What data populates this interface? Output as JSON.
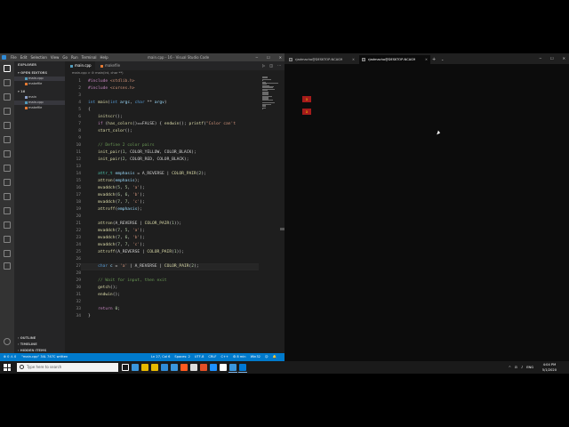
{
  "vscode": {
    "titlebar": {
      "menu": [
        "File",
        "Edit",
        "Selection",
        "View",
        "Go",
        "Run",
        "Terminal",
        "Help"
      ],
      "title": "main.cpp - 16 - Visual Studio Code",
      "min": "─",
      "max": "☐",
      "close": "✕"
    },
    "sidebar": {
      "explorer_title": "EXPLORER",
      "open_editors_label": "OPEN EDITORS",
      "open_editors": [
        {
          "name": "main.cpp",
          "type": "cpp"
        },
        {
          "name": "makefile",
          "type": "mk"
        }
      ],
      "folder_label": "16",
      "files": [
        {
          "name": "main",
          "type": "bin"
        },
        {
          "name": "main.cpp",
          "type": "cpp"
        },
        {
          "name": "makefile",
          "type": "mk"
        }
      ],
      "outline_label": "OUTLINE",
      "timeline_label": "TIMELINE",
      "hidden_items_label": "HIDDEN ITEMS"
    },
    "tabs": [
      {
        "label": "main.cpp",
        "type": "cpp",
        "active": true
      },
      {
        "label": "makefile",
        "type": "mk",
        "active": false
      }
    ],
    "breadcrumb": "main.cpp > ⊘ main(int, char **)",
    "editor": {
      "lines": [
        [
          [
            "c",
            "#include "
          ],
          [
            "s",
            "<stdlib.h>"
          ]
        ],
        [
          [
            "c",
            "#include "
          ],
          [
            "s",
            "<curses.h>"
          ]
        ],
        [],
        [
          [
            "k",
            "int "
          ],
          [
            "f",
            "main"
          ],
          [
            "",
            "("
          ],
          [
            "k",
            "int "
          ],
          [
            "v",
            "argc"
          ],
          [
            "",
            ", "
          ],
          [
            "k",
            "char "
          ],
          [
            "",
            "** "
          ],
          [
            "v",
            "argv"
          ],
          [
            "",
            ")"
          ]
        ],
        [
          [
            "",
            "{"
          ]
        ],
        [
          [
            "",
            "    "
          ],
          [
            "f",
            "initscr"
          ],
          [
            "",
            "();"
          ]
        ],
        [
          [
            "",
            "    "
          ],
          [
            "c",
            "if "
          ],
          [
            "",
            "("
          ],
          [
            "f",
            "has_colors"
          ],
          [
            "",
            "()==FALSE) { "
          ],
          [
            "f",
            "endwin"
          ],
          [
            "",
            "(); "
          ],
          [
            "f",
            "printf"
          ],
          [
            "",
            "("
          ],
          [
            "s",
            "\"Color can't"
          ]
        ],
        [
          [
            "",
            "    "
          ],
          [
            "f",
            "start_color"
          ],
          [
            "",
            "();"
          ]
        ],
        [],
        [
          [
            "",
            "    "
          ],
          [
            "cm",
            "// Define 2 color pairs"
          ]
        ],
        [
          [
            "",
            "    "
          ],
          [
            "f",
            "init_pair"
          ],
          [
            "",
            "("
          ],
          [
            "n",
            "1"
          ],
          [
            "",
            ", COLOR_YELLOW, COLOR_BLACK);"
          ]
        ],
        [
          [
            "",
            "    "
          ],
          [
            "f",
            "init_pair"
          ],
          [
            "",
            "("
          ],
          [
            "n",
            "2"
          ],
          [
            "",
            ", COLOR_RED, COLOR_BLACK);"
          ]
        ],
        [],
        [
          [
            "",
            "    "
          ],
          [
            "t",
            "attr_t "
          ],
          [
            "v",
            "emphasis"
          ],
          [
            "",
            " = A_REVERSE | "
          ],
          [
            "f",
            "COLOR_PAIR"
          ],
          [
            "",
            "("
          ],
          [
            "n",
            "2"
          ],
          [
            "",
            ");"
          ]
        ],
        [
          [
            "",
            "    "
          ],
          [
            "f",
            "attron"
          ],
          [
            "",
            "("
          ],
          [
            "v",
            "emphasis"
          ],
          [
            "",
            ");"
          ]
        ],
        [
          [
            "",
            "    "
          ],
          [
            "f",
            "mvaddch"
          ],
          [
            "",
            "("
          ],
          [
            "n",
            "5"
          ],
          [
            "",
            ", "
          ],
          [
            "n",
            "5"
          ],
          [
            "",
            ", "
          ],
          [
            "s",
            "'a'"
          ],
          [
            "",
            ");"
          ]
        ],
        [
          [
            "",
            "    "
          ],
          [
            "f",
            "mvaddch"
          ],
          [
            "",
            "("
          ],
          [
            "n",
            "6"
          ],
          [
            "",
            ", "
          ],
          [
            "n",
            "6"
          ],
          [
            "",
            ", "
          ],
          [
            "s",
            "'b'"
          ],
          [
            "",
            ");"
          ]
        ],
        [
          [
            "",
            "    "
          ],
          [
            "f",
            "mvaddch"
          ],
          [
            "",
            "("
          ],
          [
            "n",
            "7"
          ],
          [
            "",
            ", "
          ],
          [
            "n",
            "7"
          ],
          [
            "",
            ", "
          ],
          [
            "s",
            "'c'"
          ],
          [
            "",
            ");"
          ]
        ],
        [
          [
            "",
            "    "
          ],
          [
            "f",
            "attroff"
          ],
          [
            "",
            "("
          ],
          [
            "v",
            "emphasis"
          ],
          [
            "",
            ");"
          ]
        ],
        [],
        [
          [
            "",
            "    "
          ],
          [
            "f",
            "attron"
          ],
          [
            "",
            "(A_REVERSE | "
          ],
          [
            "f",
            "COLOR_PAIR"
          ],
          [
            "",
            "("
          ],
          [
            "n",
            "1"
          ],
          [
            "",
            "));"
          ]
        ],
        [
          [
            "",
            "    "
          ],
          [
            "f",
            "mvaddch"
          ],
          [
            "",
            "("
          ],
          [
            "n",
            "7"
          ],
          [
            "",
            ", "
          ],
          [
            "n",
            "5"
          ],
          [
            "",
            ", "
          ],
          [
            "s",
            "'a'"
          ],
          [
            "",
            ");"
          ]
        ],
        [
          [
            "",
            "    "
          ],
          [
            "f",
            "mvaddch"
          ],
          [
            "",
            "("
          ],
          [
            "n",
            "7"
          ],
          [
            "",
            ", "
          ],
          [
            "n",
            "6"
          ],
          [
            "",
            ", "
          ],
          [
            "s",
            "'b'"
          ],
          [
            "",
            ");"
          ]
        ],
        [
          [
            "",
            "    "
          ],
          [
            "f",
            "mvaddch"
          ],
          [
            "",
            "("
          ],
          [
            "n",
            "7"
          ],
          [
            "",
            ", "
          ],
          [
            "n",
            "7"
          ],
          [
            "",
            ", "
          ],
          [
            "s",
            "'c'"
          ],
          [
            "",
            ");"
          ]
        ],
        [
          [
            "",
            "    "
          ],
          [
            "f",
            "attroff"
          ],
          [
            "",
            "(A_REVERSE | "
          ],
          [
            "f",
            "COLOR_PAIR"
          ],
          [
            "",
            "("
          ],
          [
            "n",
            "1"
          ],
          [
            "",
            "));"
          ]
        ],
        [],
        [
          [
            "",
            "    "
          ],
          [
            "k",
            "char "
          ],
          [
            "v",
            "c"
          ],
          [
            "",
            " = "
          ],
          [
            "s",
            "'a'"
          ],
          [
            "",
            " | A_REVERSE | "
          ],
          [
            "f",
            "COLOR_PAIR"
          ],
          [
            "",
            "("
          ],
          [
            "n",
            "2"
          ],
          [
            "",
            ");"
          ]
        ],
        [],
        [
          [
            "",
            "    "
          ],
          [
            "cm",
            "// Wait for input, then exit"
          ]
        ],
        [
          [
            "",
            "    "
          ],
          [
            "f",
            "getch"
          ],
          [
            "",
            "();"
          ]
        ],
        [
          [
            "",
            "    "
          ],
          [
            "f",
            "endwin"
          ],
          [
            "",
            "();"
          ]
        ],
        [],
        [
          [
            "",
            "    "
          ],
          [
            "c",
            "return "
          ],
          [
            "n",
            "0"
          ],
          [
            "",
            ";"
          ]
        ],
        [
          [
            "",
            "}"
          ]
        ]
      ],
      "current_line": 27
    },
    "statusbar": {
      "left": [
        "⊗ 0 ⚠ 0",
        "\"main.cpp\" 34L 747C written"
      ],
      "right": [
        "Ln 27, Col 6",
        "Spaces: 2",
        "UTF-8",
        "CRLF",
        "C++",
        "⚙ 8 min",
        "Win32",
        "☺",
        "🔔"
      ]
    }
  },
  "terminal": {
    "tabs": [
      {
        "label": "rjadmacho@DESKTOP-NCAG9",
        "active": false
      },
      {
        "label": "rjadmacho@DESKTOP-NCAG9",
        "active": true
      }
    ],
    "new_tab": "+",
    "dropdown": "⌄",
    "min": "─",
    "max": "☐",
    "close": "✕",
    "cells": [
      "a",
      "a"
    ]
  },
  "taskbar": {
    "search_placeholder": "Type here to search",
    "time": "4:04 PM",
    "date": "5/1/2020",
    "tray": [
      "^",
      "⊡",
      "♪",
      "ENG"
    ],
    "app_colors": [
      "#ffffff",
      "#3a96dd",
      "#e6b800",
      "#e6b800",
      "#2f8bd8",
      "#3a96dd",
      "#ff5a1f",
      "#dddddd",
      "#e34f26",
      "#1e90ff",
      "#ffffff",
      "#3a96dd",
      "#0078d4"
    ]
  },
  "colors": {
    "accent": "#007acc",
    "terminal_cell_bg": "#a51b1b",
    "terminal_cell_fg": "#e6b800"
  }
}
